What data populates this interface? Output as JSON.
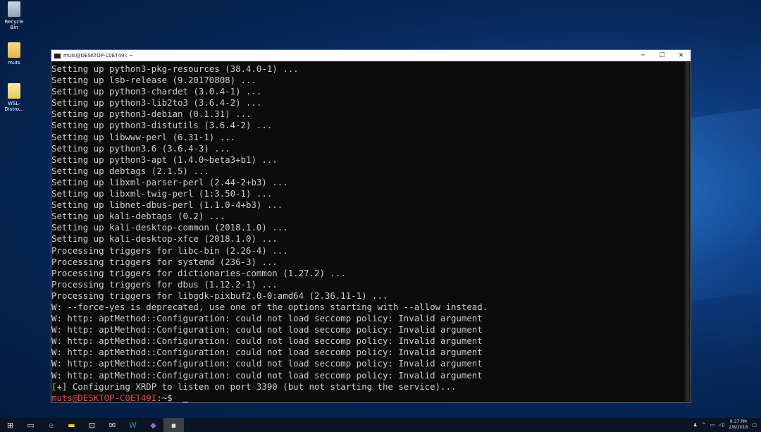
{
  "desktop": {
    "icons": [
      {
        "label": "Recycle Bin"
      },
      {
        "label": "muts"
      },
      {
        "label": "WSL-Distro..."
      }
    ]
  },
  "terminal": {
    "title": "muts@DESKTOP-C0ET49I: ~",
    "controls": {
      "minimize": "─",
      "maximize": "☐",
      "close": "✕"
    },
    "lines": [
      "Setting up python3-pkg-resources (38.4.0-1) ...",
      "Setting up lsb-release (9.20170808) ...",
      "Setting up python3-chardet (3.0.4-1) ...",
      "Setting up python3-lib2to3 (3.6.4-2) ...",
      "Setting up python3-debian (0.1.31) ...",
      "Setting up python3-distutils (3.6.4-2) ...",
      "Setting up libwww-perl (6.31-1) ...",
      "Setting up python3.6 (3.6.4-3) ...",
      "Setting up python3-apt (1.4.0~beta3+b1) ...",
      "Setting up debtags (2.1.5) ...",
      "Setting up libxml-parser-perl (2.44-2+b3) ...",
      "Setting up libxml-twig-perl (1:3.50-1) ...",
      "Setting up libnet-dbus-perl (1.1.0-4+b3) ...",
      "Setting up kali-debtags (0.2) ...",
      "Setting up kali-desktop-common (2018.1.0) ...",
      "Setting up kali-desktop-xfce (2018.1.0) ...",
      "Processing triggers for libc-bin (2.26-4) ...",
      "Processing triggers for systemd (236-3) ...",
      "Processing triggers for dictionaries-common (1.27.2) ...",
      "Processing triggers for dbus (1.12.2-1) ...",
      "Processing triggers for libgdk-pixbuf2.0-0:amd64 (2.36.11-1) ...",
      "W: --force-yes is deprecated, use one of the options starting with --allow instead.",
      "W: http: aptMethod::Configuration: could not load seccomp policy: Invalid argument",
      "W: http: aptMethod::Configuration: could not load seccomp policy: Invalid argument",
      "W: http: aptMethod::Configuration: could not load seccomp policy: Invalid argument",
      "W: http: aptMethod::Configuration: could not load seccomp policy: Invalid argument",
      "W: http: aptMethod::Configuration: could not load seccomp policy: Invalid argument",
      "W: http: aptMethod::Configuration: could not load seccomp policy: Invalid argument",
      "[+] Configuring XRDP to listen on port 3390 (but not starting the service)..."
    ],
    "prompt": {
      "user_host": "muts@DESKTOP-C0ET49I",
      "sep": ":",
      "path": "~$"
    }
  },
  "taskbar": {
    "clock_time": "9:37 PM",
    "clock_date": "2/8/2018"
  }
}
